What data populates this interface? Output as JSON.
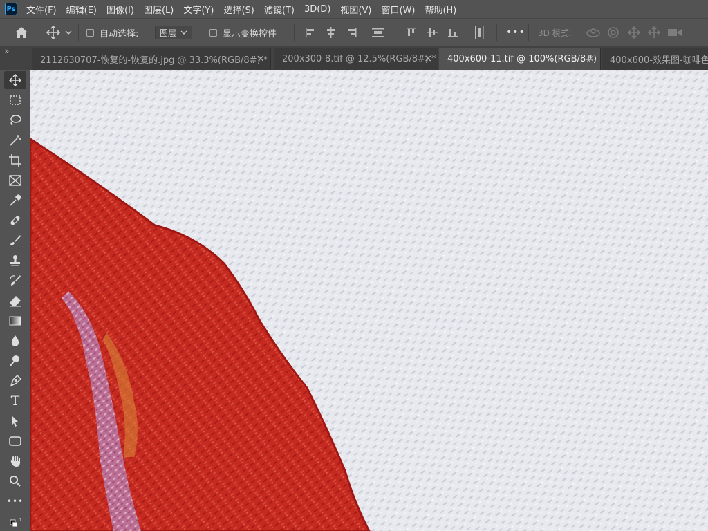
{
  "app": {
    "logo": "Ps"
  },
  "menu": [
    "文件(F)",
    "编辑(E)",
    "图像(I)",
    "图层(L)",
    "文字(Y)",
    "选择(S)",
    "滤镜(T)",
    "3D(D)",
    "视图(V)",
    "窗口(W)",
    "帮助(H)"
  ],
  "options": {
    "auto_select_label": "自动选择:",
    "auto_select_checked": false,
    "layer_select_value": "图层",
    "show_transform_label": "显示变换控件",
    "show_transform_checked": false,
    "more_label": "•••",
    "mode_3d_label": "3D 模式:"
  },
  "tabs": [
    {
      "label": "2112630707-恢复的-恢复的.jpg @ 33.3%(RGB/8#) *",
      "active": false
    },
    {
      "label": "200x300-8.tif @ 12.5%(RGB/8#) *",
      "active": false
    },
    {
      "label": "400x600-11.tif @ 100%(RGB/8#)",
      "active": true
    },
    {
      "label": "400x600-效果图-咖啡色",
      "active": false
    }
  ],
  "tab_close_glyph": "×",
  "panel_toggle_glyph": "»",
  "tools": [
    {
      "name": "move-tool",
      "icon": "move-icon",
      "selected": true
    },
    {
      "name": "marquee-tool",
      "icon": "marquee-icon"
    },
    {
      "name": "lasso-tool",
      "icon": "lasso-icon"
    },
    {
      "name": "magic-wand-tool",
      "icon": "magic-wand-icon"
    },
    {
      "name": "crop-tool",
      "icon": "crop-icon"
    },
    {
      "name": "frame-tool",
      "icon": "frame-icon"
    },
    {
      "name": "eyedropper-tool",
      "icon": "eyedropper-icon"
    },
    {
      "name": "healing-brush-tool",
      "icon": "bandage-icon"
    },
    {
      "name": "brush-tool",
      "icon": "brush-icon"
    },
    {
      "name": "clone-stamp-tool",
      "icon": "stamp-icon"
    },
    {
      "name": "history-brush-tool",
      "icon": "history-brush-icon"
    },
    {
      "name": "eraser-tool",
      "icon": "eraser-icon"
    },
    {
      "name": "gradient-tool",
      "icon": "gradient-icon"
    },
    {
      "name": "blur-tool",
      "icon": "drop-icon"
    },
    {
      "name": "dodge-tool",
      "icon": "dodge-icon"
    },
    {
      "name": "pen-tool",
      "icon": "pen-icon"
    },
    {
      "name": "type-tool",
      "icon": "type-icon",
      "text": "T"
    },
    {
      "name": "path-selection-tool",
      "icon": "arrow-icon"
    },
    {
      "name": "rectangle-tool",
      "icon": "rounded-rect-icon"
    },
    {
      "name": "hand-tool",
      "icon": "hand-icon"
    },
    {
      "name": "zoom-tool",
      "icon": "magnifier-icon"
    },
    {
      "name": "edit-toolbar",
      "icon": "ellipsis-icon",
      "text": "•••"
    }
  ],
  "colors": {
    "ui_bg": "#535353",
    "tab_bg": "#3b3b3b",
    "canvas_bg": "#e6e8ee",
    "red_shape": "#c4271f"
  }
}
